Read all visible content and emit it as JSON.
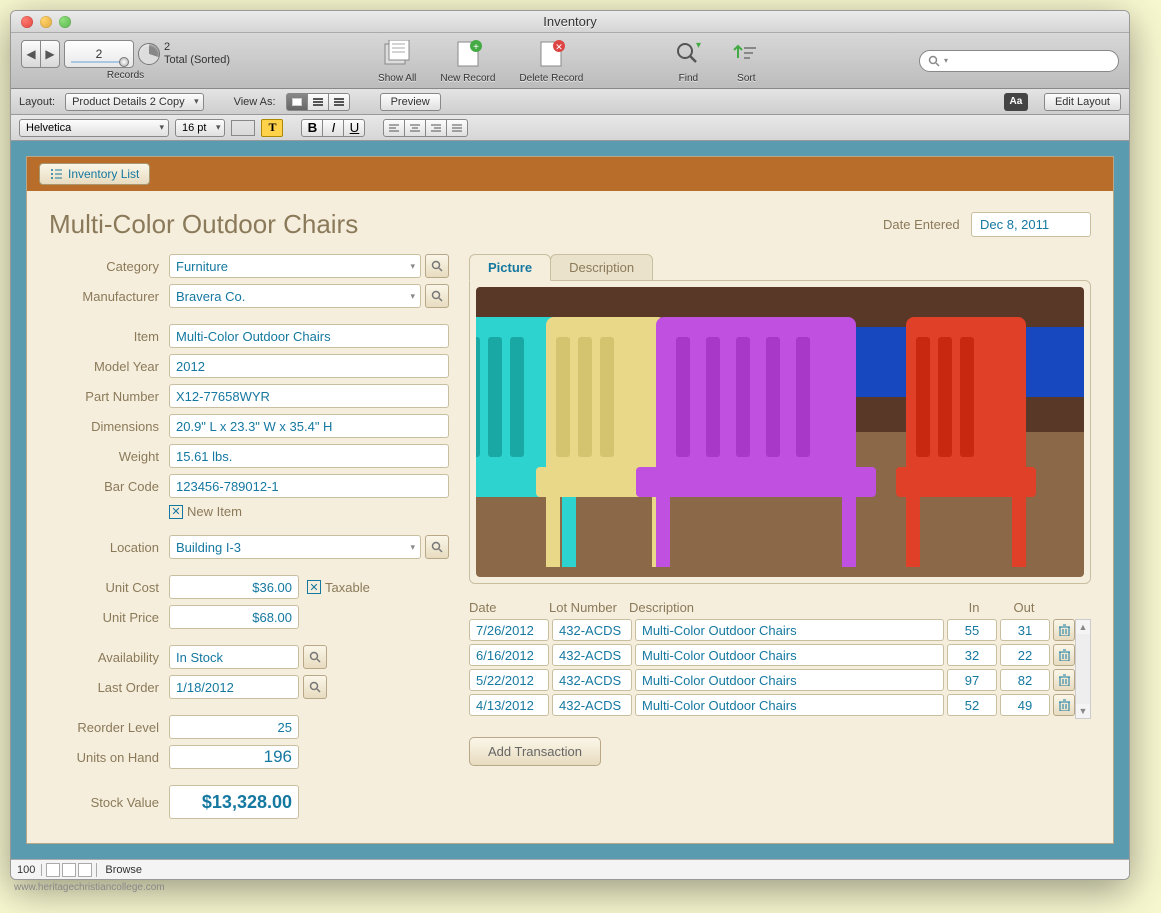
{
  "window": {
    "title": "Inventory"
  },
  "toolbar": {
    "record_num": "2",
    "record_total": "2",
    "record_total_label": "Total (Sorted)",
    "records_label": "Records",
    "show_all": "Show All",
    "new_record": "New Record",
    "delete_record": "Delete Record",
    "find": "Find",
    "sort": "Sort",
    "search_icon": "search-icon"
  },
  "layoutbar": {
    "layout_label": "Layout:",
    "layout_value": "Product Details 2 Copy",
    "view_as": "View As:",
    "preview": "Preview",
    "aa": "Aa",
    "edit_layout": "Edit Layout"
  },
  "formatbar": {
    "font": "Helvetica",
    "size": "16 pt",
    "fill": "#000000",
    "text_highlight": "T",
    "bold": "B",
    "italic": "I",
    "underline": "U"
  },
  "page": {
    "inventory_list": "Inventory List",
    "title": "Multi-Color Outdoor Chairs",
    "date_entered_label": "Date Entered",
    "date_entered": "Dec 8, 2011",
    "tabs": {
      "picture": "Picture",
      "description": "Description"
    }
  },
  "fields": {
    "category_label": "Category",
    "category": "Furniture",
    "manufacturer_label": "Manufacturer",
    "manufacturer": "Bravera Co.",
    "item_label": "Item",
    "item": "Multi-Color Outdoor Chairs",
    "model_year_label": "Model Year",
    "model_year": "2012",
    "part_number_label": "Part Number",
    "part_number": "X12-77658WYR",
    "dimensions_label": "Dimensions",
    "dimensions": "20.9\" L x 23.3\" W x 35.4\" H",
    "weight_label": "Weight",
    "weight": "15.61 lbs.",
    "barcode_label": "Bar Code",
    "barcode": "123456-789012-1",
    "new_item_label": "New Item",
    "new_item_checked": true,
    "location_label": "Location",
    "location": "Building I-3",
    "unit_cost_label": "Unit Cost",
    "unit_cost": "$36.00",
    "taxable_label": "Taxable",
    "taxable_checked": true,
    "unit_price_label": "Unit Price",
    "unit_price": "$68.00",
    "availability_label": "Availability",
    "availability": "In Stock",
    "last_order_label": "Last Order",
    "last_order": "1/18/2012",
    "reorder_level_label": "Reorder Level",
    "reorder_level": "25",
    "units_on_hand_label": "Units on Hand",
    "units_on_hand": "196",
    "stock_value_label": "Stock Value",
    "stock_value": "$13,328.00"
  },
  "tx": {
    "head_date": "Date",
    "head_lot": "Lot Number",
    "head_desc": "Description",
    "head_in": "In",
    "head_out": "Out",
    "rows": [
      {
        "date": "7/26/2012",
        "lot": "432-ACDS",
        "desc": "Multi-Color Outdoor Chairs",
        "in": "55",
        "out": "31"
      },
      {
        "date": "6/16/2012",
        "lot": "432-ACDS",
        "desc": "Multi-Color Outdoor Chairs",
        "in": "32",
        "out": "22"
      },
      {
        "date": "5/22/2012",
        "lot": "432-ACDS",
        "desc": "Multi-Color Outdoor Chairs",
        "in": "97",
        "out": "82"
      },
      {
        "date": "4/13/2012",
        "lot": "432-ACDS",
        "desc": "Multi-Color Outdoor Chairs",
        "in": "52",
        "out": "49"
      }
    ],
    "add": "Add Transaction"
  },
  "statusbar": {
    "zoom": "100",
    "mode": "Browse"
  },
  "footer": {
    "url": "www.heritagechristiancollege.com"
  }
}
